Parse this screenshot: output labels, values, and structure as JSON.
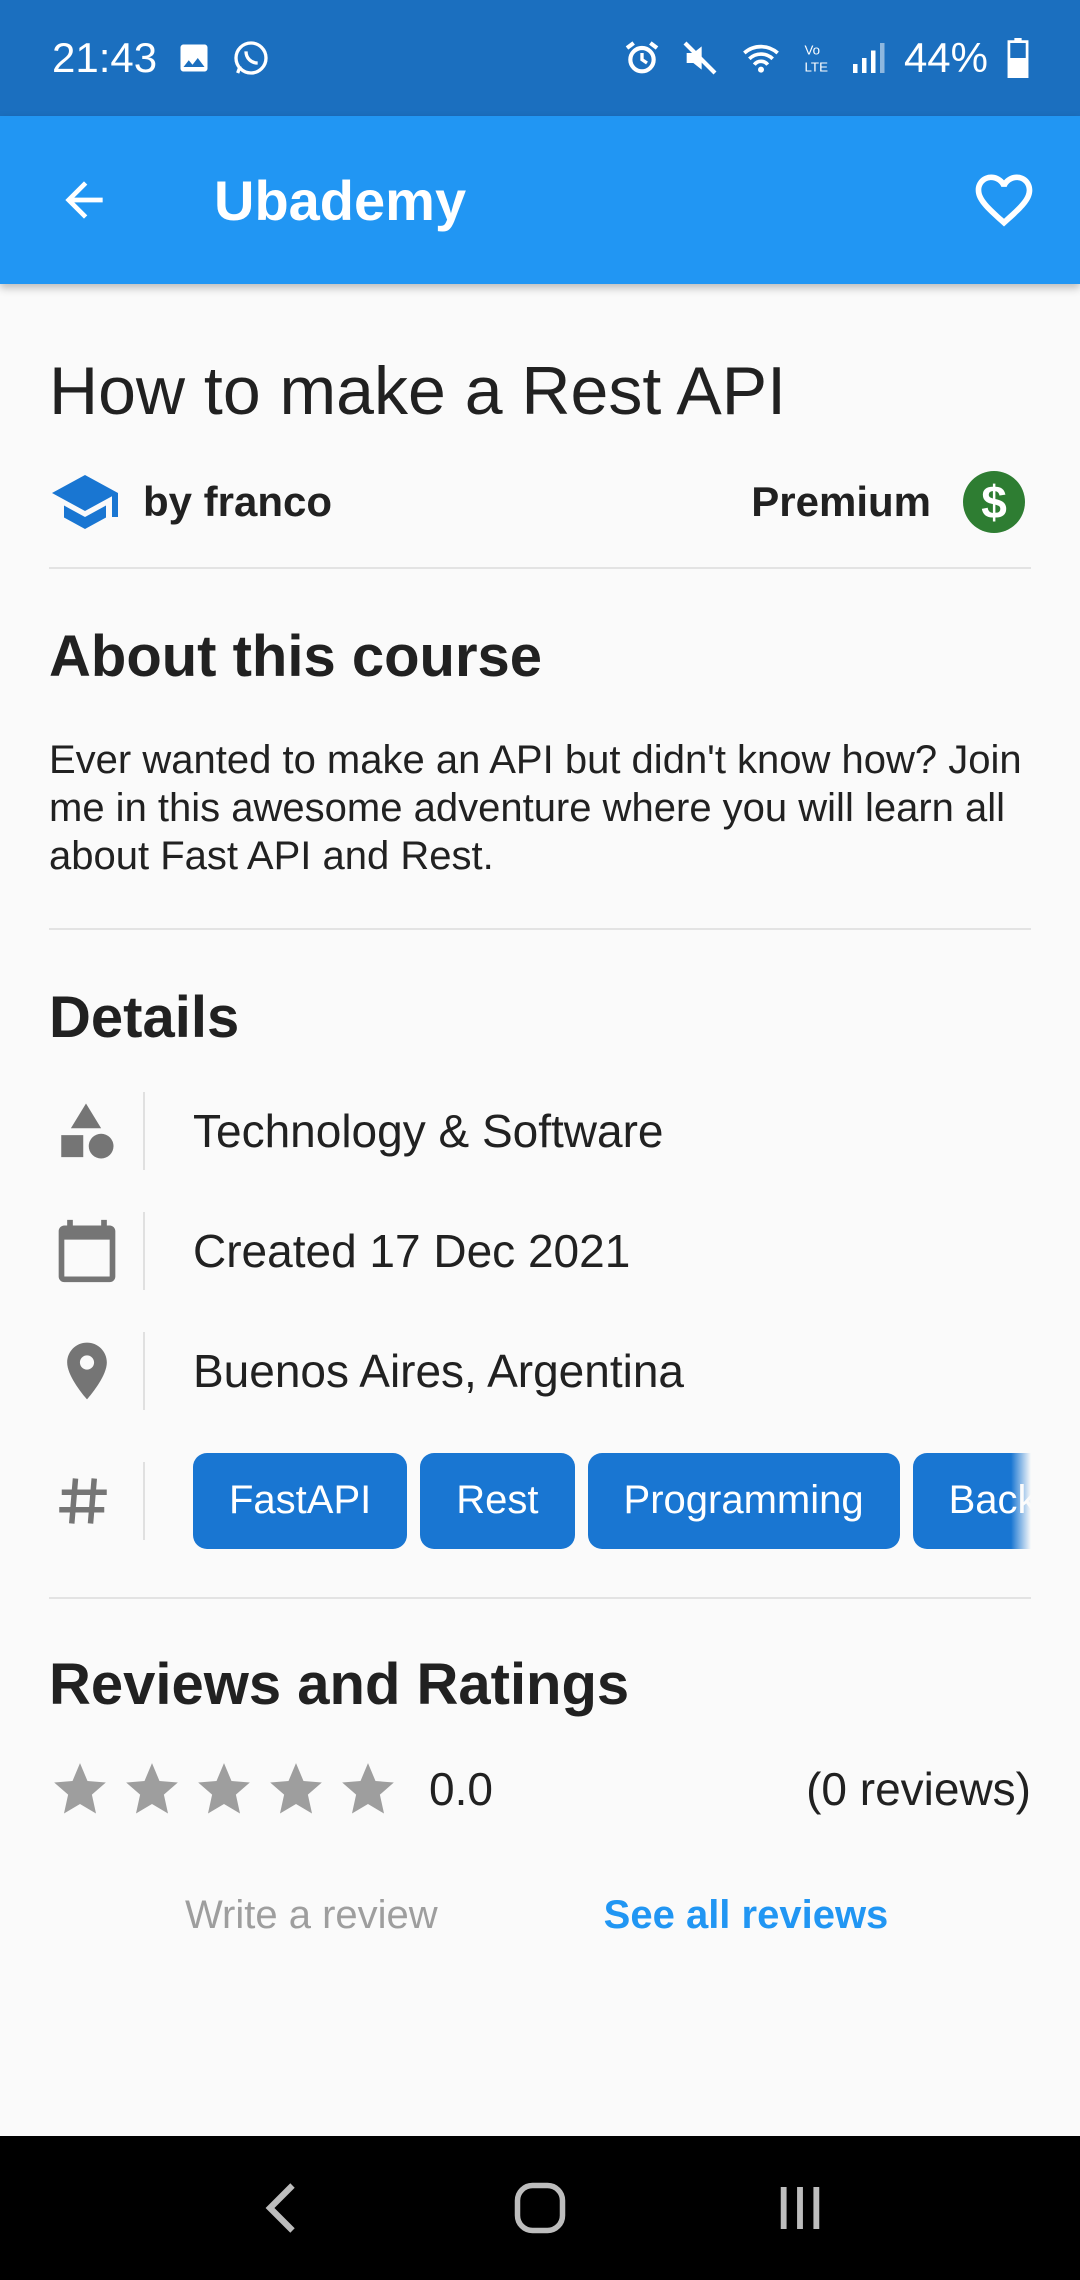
{
  "status_bar": {
    "time": "21:43",
    "battery": "44%",
    "left_icons": [
      "image-icon",
      "whatsapp-icon"
    ],
    "right_icons": [
      "alarm-icon",
      "mute-icon",
      "wifi-icon",
      "volte-icon",
      "signal-icon",
      "battery-icon"
    ]
  },
  "app_bar": {
    "title": "Ubademy",
    "back_icon": "arrow-back-icon",
    "favorite_icon": "heart-outline-icon"
  },
  "course": {
    "title": "How to make a Rest API",
    "author": "by franco",
    "tier": "Premium",
    "tier_icon": "dollar-icon",
    "tier_symbol": "$"
  },
  "about": {
    "heading": "About this course",
    "text": "Ever wanted to make an API but didn't know how? Join me in this awesome adventure where you will learn all about Fast API and Rest."
  },
  "details": {
    "heading": "Details",
    "category": "Technology & Software",
    "created": "Created 17 Dec 2021",
    "location": "Buenos Aires, Argentina",
    "tags": [
      "FastAPI",
      "Rest",
      "Programming",
      "Backend"
    ]
  },
  "reviews": {
    "heading": "Reviews and Ratings",
    "rating": "0.0",
    "stars_filled": 0,
    "stars_total": 5,
    "count_label": "(0 reviews)",
    "write_review": "Write a review",
    "see_all": "See all reviews"
  },
  "colors": {
    "status_bar": "#1b6fbf",
    "app_bar": "#2196f3",
    "tag": "#1976d2",
    "premium": "#2e7d32",
    "link": "#2196f3"
  }
}
